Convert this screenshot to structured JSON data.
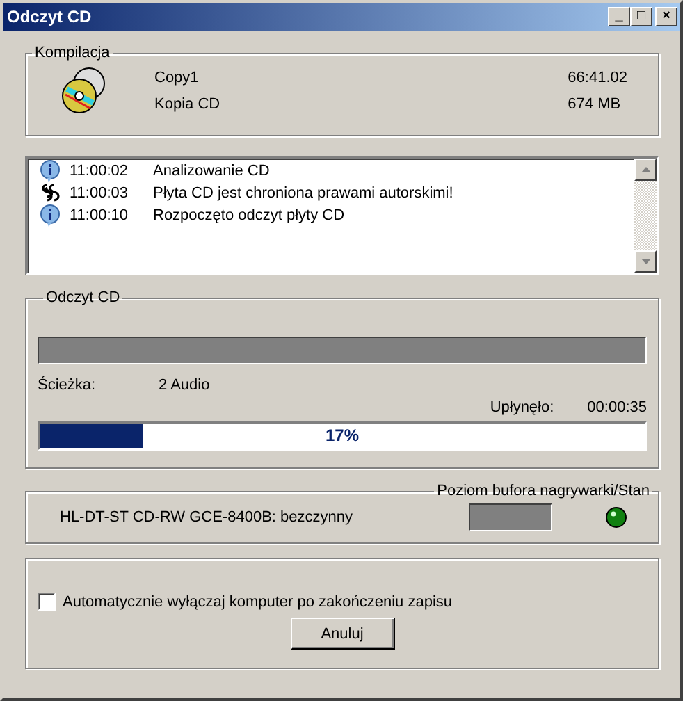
{
  "window": {
    "title": "Odczyt CD",
    "controls": [
      "_",
      "□",
      "×"
    ]
  },
  "compilation": {
    "label": "Kompilacja",
    "name": "Copy1",
    "type": "Kopia CD",
    "duration": "66:41.02",
    "size": "674 MB"
  },
  "log": [
    {
      "kind": "info",
      "time": "11:00:02",
      "message": "Analizowanie CD"
    },
    {
      "kind": "copyright",
      "time": "11:00:03",
      "message": "Płyta CD jest chroniona prawami autorskimi!"
    },
    {
      "kind": "info",
      "time": "11:00:10",
      "message": "Rozpoczęto odczyt płyty CD"
    }
  ],
  "reading": {
    "label": "Odczyt CD",
    "track_label": "Ścieżka:",
    "track_value": "2  Audio",
    "elapsed_label": "Upłynęło:",
    "elapsed_value": "00:00:35",
    "progress": {
      "level": 0.17,
      "text": "17%"
    }
  },
  "buffer": {
    "label": "Poziom bufora nagrywarki/Stan",
    "device": "HL-DT-ST CD-RW GCE-8400B: bezczynny"
  },
  "options": {
    "shutdown": {
      "label": "Automatycznie wyłączaj komputer po zakończeniu zapisu",
      "checked": false
    },
    "cancel": "Anuluj"
  }
}
